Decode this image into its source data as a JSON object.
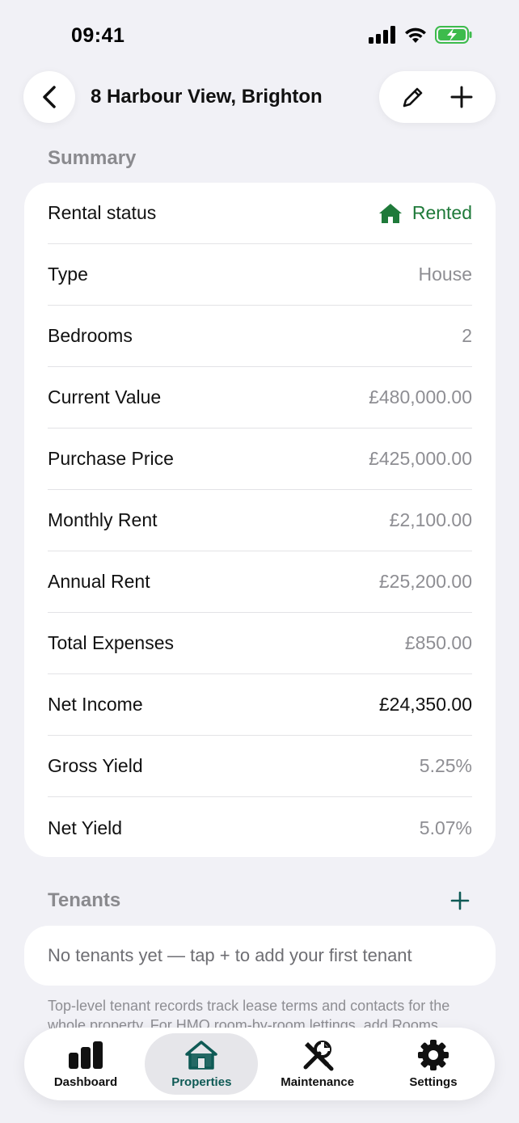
{
  "status_bar": {
    "time": "09:41"
  },
  "nav": {
    "title": "8 Harbour View, Brighton"
  },
  "summary": {
    "section_title": "Summary",
    "rows": [
      {
        "label": "Rental status",
        "value": "Rented"
      },
      {
        "label": "Type",
        "value": "House"
      },
      {
        "label": "Bedrooms",
        "value": "2"
      },
      {
        "label": "Current Value",
        "value": "£480,000.00"
      },
      {
        "label": "Purchase Price",
        "value": "£425,000.00"
      },
      {
        "label": "Monthly Rent",
        "value": "£2,100.00"
      },
      {
        "label": "Annual Rent",
        "value": "£25,200.00"
      },
      {
        "label": "Total Expenses",
        "value": "£850.00"
      },
      {
        "label": "Net Income",
        "value": "£24,350.00"
      },
      {
        "label": "Gross Yield",
        "value": "5.25%"
      },
      {
        "label": "Net Yield",
        "value": "5.07%"
      }
    ]
  },
  "tenants": {
    "section_title": "Tenants",
    "empty_text": "No tenants yet — tap + to add your first tenant",
    "footnote": "Top-level tenant records track lease terms and contacts for the whole property. For HMO room-by-room lettings, add Rooms"
  },
  "tabbar": {
    "items": [
      {
        "label": "Dashboard",
        "icon": "chart-bar-icon"
      },
      {
        "label": "Properties",
        "icon": "house-icon"
      },
      {
        "label": "Maintenance",
        "icon": "wrench-screwdriver-icon"
      },
      {
        "label": "Settings",
        "icon": "gear-icon"
      }
    ],
    "active": "Properties"
  },
  "colors": {
    "accent": "#0e5a55",
    "rented": "#1f7a3a",
    "background": "#f1f1f6"
  }
}
